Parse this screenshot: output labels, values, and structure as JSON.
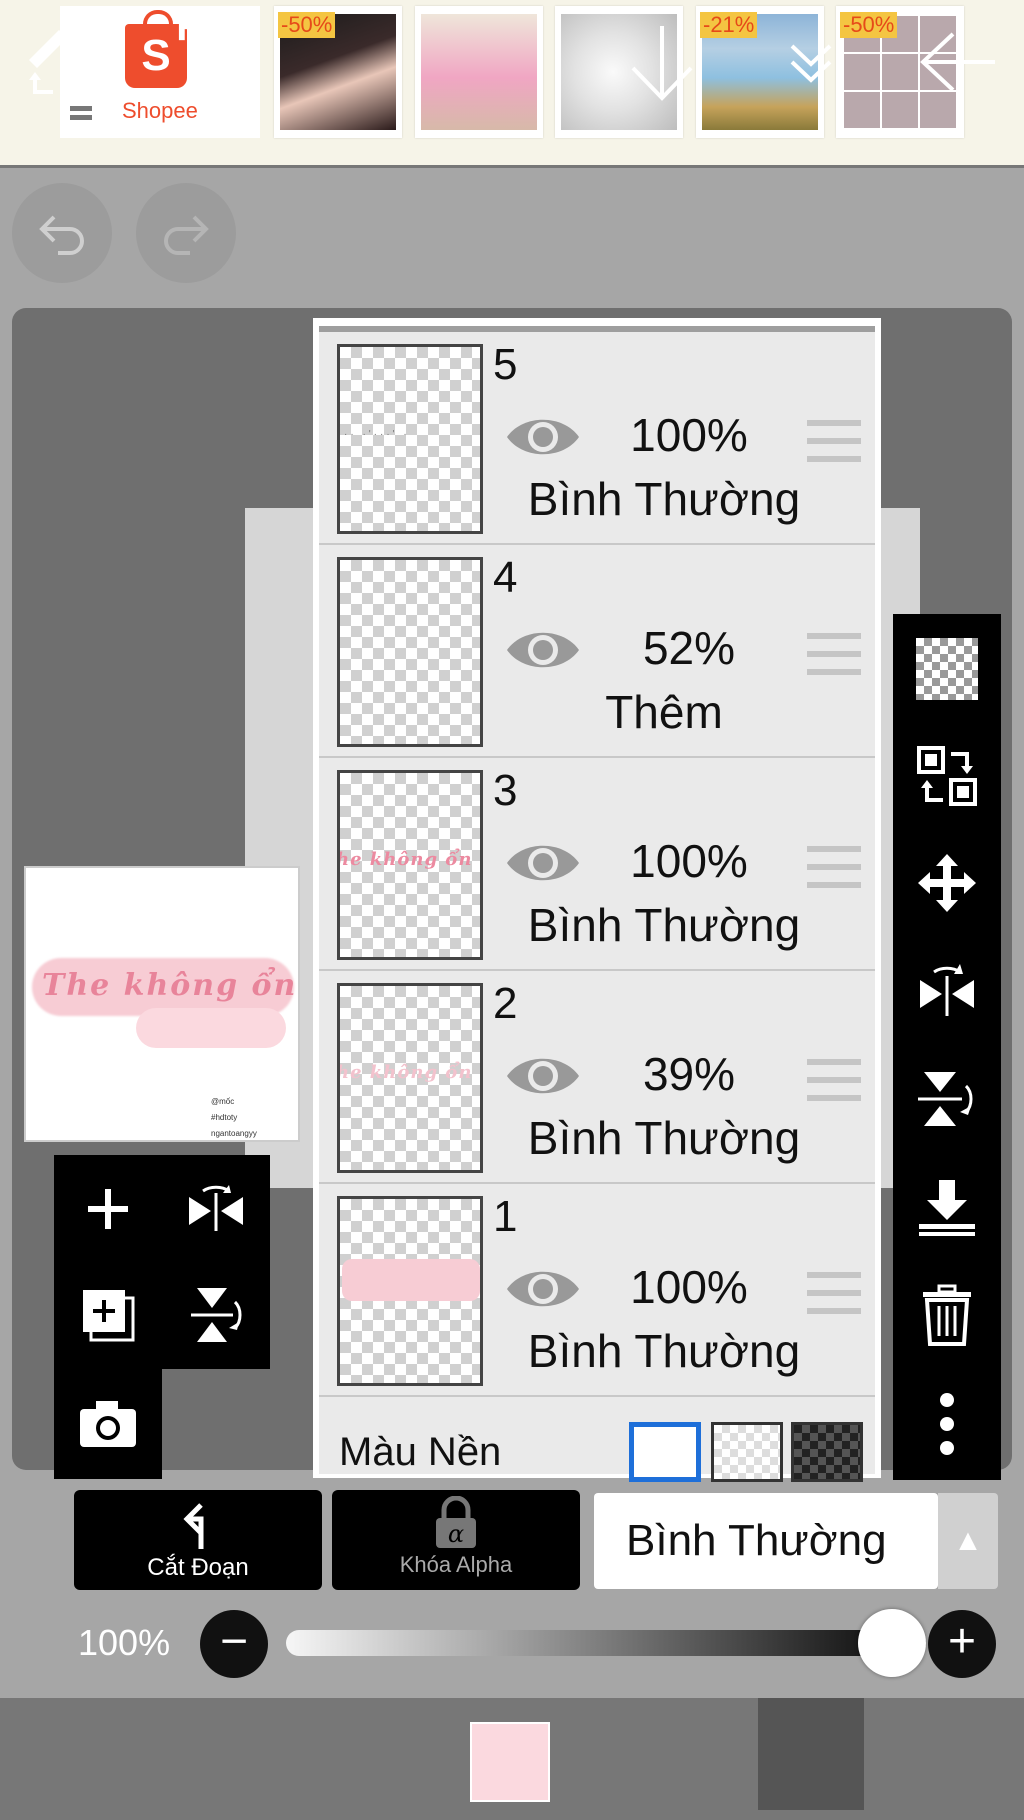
{
  "ad_bar": {
    "shopee_label": "Shopee",
    "products": [
      {
        "badge": "-50%"
      },
      {
        "badge": ""
      },
      {
        "badge": ""
      },
      {
        "badge": "-21%"
      },
      {
        "badge": "-50%"
      }
    ]
  },
  "history": {
    "undo_icon": "undo-icon",
    "redo_icon": "redo-icon"
  },
  "preview": {
    "script_text": "The không ổn",
    "credits": [
      "@mốc",
      "#hdtoty",
      "ngantoangyy"
    ]
  },
  "layers": [
    {
      "number": "5",
      "opacity": "100%",
      "mode": "Bình Thường",
      "visible": true
    },
    {
      "number": "4",
      "opacity": "52%",
      "mode": "Thêm",
      "visible": true
    },
    {
      "number": "3",
      "opacity": "100%",
      "mode": "Bình Thường",
      "visible": true
    },
    {
      "number": "2",
      "opacity": "39%",
      "mode": "Bình Thường",
      "visible": true
    },
    {
      "number": "1",
      "opacity": "100%",
      "mode": "Bình Thường",
      "visible": true
    }
  ],
  "background": {
    "label": "Màu Nền"
  },
  "controls": {
    "clip_label": "Cắt Đoạn",
    "alpha_lock_label": "Khóa Alpha",
    "blend_mode": "Bình Thường",
    "opacity_label": "100%",
    "opacity_value": 1.0
  },
  "colors": {
    "current_color": "#fbd9df",
    "shopee": "#ee4d2d"
  }
}
